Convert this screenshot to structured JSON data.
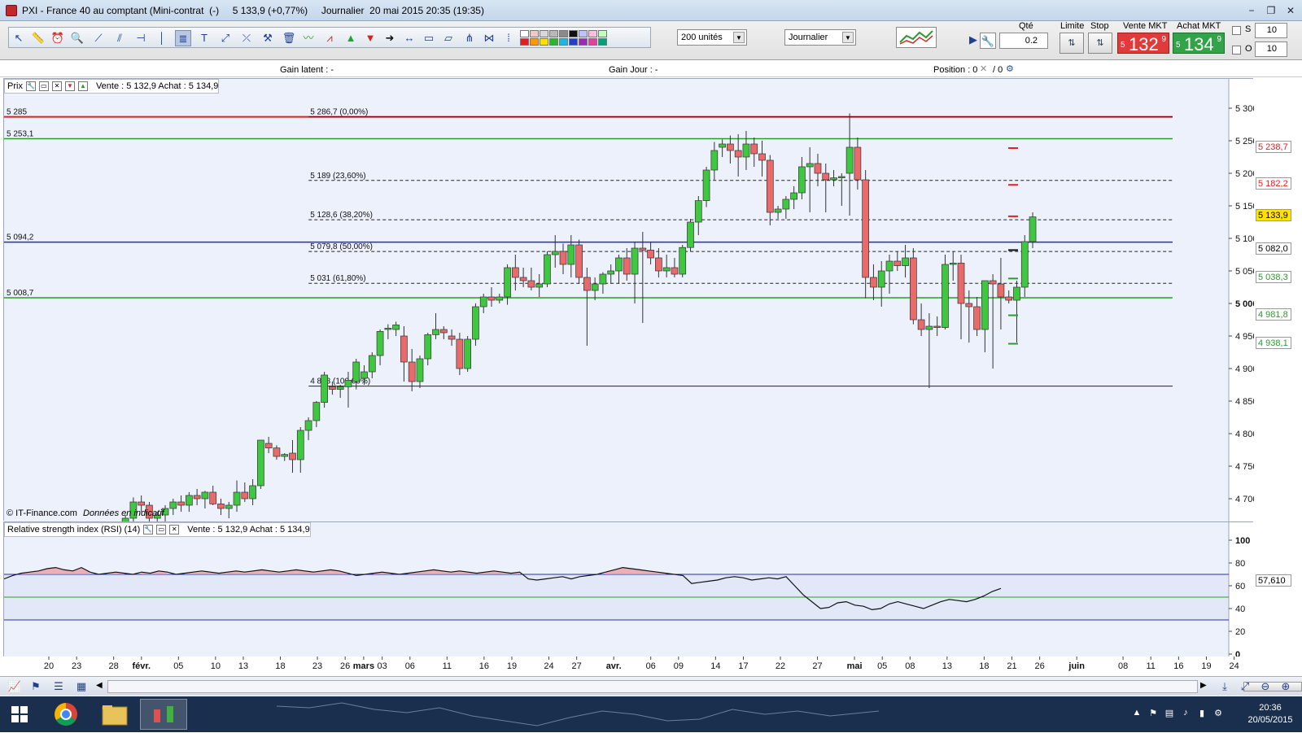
{
  "window": {
    "title": "PXI - France 40 au comptant (Mini-contrat  (-)     5 133,9 (+0,77%)     Journalier  20 mai 2015 20:35 (19:35)",
    "minimize": "−",
    "restore": "❐",
    "close": "✕"
  },
  "toolbar": {
    "units_select": "200 unités",
    "period_select": "Journalier",
    "qty_label": "Qté",
    "qty_value": "0.2",
    "limit_label": "Limite",
    "stop_label": "Stop",
    "sell_label": "Vente MKT",
    "buy_label": "Achat MKT",
    "sell_small": "5",
    "sell_big": "132",
    "sell_sup": "9",
    "buy_small": "5",
    "buy_big": "134",
    "buy_sup": "9",
    "s_label": "S",
    "o_label": "O",
    "s_value": "10",
    "o_value": "10",
    "colors": {
      "sell": "#e03b3b",
      "buy": "#33a34a"
    }
  },
  "infobar": {
    "gain_latent": "Gain latent : -",
    "gain_jour": "Gain Jour : -",
    "position": "Position : 0",
    "position_after": "/ 0"
  },
  "price_panel": {
    "label": "Prix",
    "quote": "Vente : 5 132,9  Achat : 5 134,9",
    "copyright": "© IT-Finance.com",
    "indicative": "Données en indicatif"
  },
  "rsi_panel": {
    "label": "Relative strength index (RSI) (14)",
    "quote": "Vente : 5 132,9  Achat : 5 134,9",
    "value_tag": "57,610"
  },
  "chart_data": [
    {
      "type": "candlestick",
      "title": "PXI - France 40 au comptant (Mini-contrat",
      "ylim": [
        4670,
        5320
      ],
      "y_ticks": [
        {
          "v": 5300,
          "t": "5 300"
        },
        {
          "v": 5250,
          "t": "5 250"
        },
        {
          "v": 5200,
          "t": "5 200"
        },
        {
          "v": 5150,
          "t": "5 150"
        },
        {
          "v": 5100,
          "t": "5 100"
        },
        {
          "v": 5050,
          "t": "5 050"
        },
        {
          "v": 5000,
          "t": "5 000",
          "bold": true
        },
        {
          "v": 4950,
          "t": "4 950"
        },
        {
          "v": 4900,
          "t": "4 900"
        },
        {
          "v": 4850,
          "t": "4 850"
        },
        {
          "v": 4800,
          "t": "4 800"
        },
        {
          "v": 4750,
          "t": "4 750"
        },
        {
          "v": 4700,
          "t": "4 700"
        }
      ],
      "x_ticks": [
        {
          "i": 0,
          "t": "20"
        },
        {
          "i": 3,
          "t": "23"
        },
        {
          "i": 7,
          "t": "28"
        },
        {
          "i": 10,
          "t": "févr."
        },
        {
          "i": 14,
          "t": "05"
        },
        {
          "i": 18,
          "t": "10"
        },
        {
          "i": 21,
          "t": "13"
        },
        {
          "i": 25,
          "t": "18"
        },
        {
          "i": 29,
          "t": "23"
        },
        {
          "i": 32,
          "t": "26"
        },
        {
          "i": 34,
          "t": "mars"
        },
        {
          "i": 36,
          "t": "03"
        },
        {
          "i": 39,
          "t": "06"
        },
        {
          "i": 43,
          "t": "11"
        },
        {
          "i": 47,
          "t": "16"
        },
        {
          "i": 50,
          "t": "19"
        },
        {
          "i": 54,
          "t": "24"
        },
        {
          "i": 57,
          "t": "27"
        },
        {
          "i": 61,
          "t": "avr."
        },
        {
          "i": 65,
          "t": "06"
        },
        {
          "i": 68,
          "t": "09"
        },
        {
          "i": 72,
          "t": "14"
        },
        {
          "i": 75,
          "t": "17"
        },
        {
          "i": 79,
          "t": "22"
        },
        {
          "i": 83,
          "t": "27"
        },
        {
          "i": 87,
          "t": "mai"
        },
        {
          "i": 90,
          "t": "05"
        },
        {
          "i": 93,
          "t": "08"
        },
        {
          "i": 97,
          "t": "13"
        },
        {
          "i": 101,
          "t": "18"
        },
        {
          "i": 104,
          "t": "21"
        },
        {
          "i": 107,
          "t": "26"
        },
        {
          "i": 111,
          "t": "juin"
        },
        {
          "i": 116,
          "t": "08"
        },
        {
          "i": 119,
          "t": "11"
        },
        {
          "i": 122,
          "t": "16"
        },
        {
          "i": 125,
          "t": "19"
        },
        {
          "i": 128,
          "t": "24"
        }
      ],
      "h_lines": [
        {
          "v": 5286.7,
          "label": "5 285",
          "color": "#e02020",
          "width": 2
        },
        {
          "v": 5253.1,
          "label": "5 253,1",
          "color": "#2d9a2d",
          "width": 1.5
        },
        {
          "v": 5094.2,
          "label": "5 094,2",
          "color": "#2a2ab0",
          "width": 1.5
        },
        {
          "v": 5008.7,
          "label": "5 008,7",
          "color": "#2d9a2d",
          "width": 1.5
        }
      ],
      "fibonacci": [
        {
          "v": 5286.7,
          "label": "5 286,7 (0,00%)",
          "solid": true
        },
        {
          "v": 5189,
          "label": "5 189 (23,60%)"
        },
        {
          "v": 5128.6,
          "label": "5 128,6 (38,20%)"
        },
        {
          "v": 5079.8,
          "label": "5 079,8 (50,00%)"
        },
        {
          "v": 5031,
          "label": "5 031 (61,80%)"
        },
        {
          "v": 4873,
          "label": "4 873 (100,00%)",
          "solid": true
        }
      ],
      "fib_start_index": 31,
      "right_tags": [
        {
          "v": 5238.7,
          "t": "5 238,7",
          "color": "#e02020",
          "bg": "#fff"
        },
        {
          "v": 5182.2,
          "t": "5 182,2",
          "color": "#e02020",
          "bg": "#fff"
        },
        {
          "v": 5133.9,
          "t": "5 133,9",
          "color": "#000",
          "bg": "#ffe400"
        },
        {
          "v": 5082.0,
          "t": "5 082,0",
          "color": "#000",
          "bg": "#fff"
        },
        {
          "v": 5038.3,
          "t": "5 038,3",
          "color": "#2d9a2d",
          "bg": "#fff"
        },
        {
          "v": 4981.8,
          "t": "4 981,8",
          "color": "#2d9a2d",
          "bg": "#fff"
        },
        {
          "v": 4938.1,
          "t": "4 938,1",
          "color": "#2d9a2d",
          "bg": "#fff"
        }
      ],
      "candles": [
        [
          4655,
          4665,
          4640,
          4650
        ],
        [
          4650,
          4660,
          4635,
          4645
        ],
        [
          4645,
          4655,
          4630,
          4652
        ],
        [
          4652,
          4662,
          4640,
          4648
        ],
        [
          4648,
          4675,
          4640,
          4670
        ],
        [
          4670,
          4702,
          4660,
          4695
        ],
        [
          4695,
          4705,
          4680,
          4690
        ],
        [
          4690,
          4695,
          4665,
          4670
        ],
        [
          4670,
          4680,
          4655,
          4675
        ],
        [
          4675,
          4690,
          4665,
          4685
        ],
        [
          4685,
          4700,
          4675,
          4695
        ],
        [
          4695,
          4705,
          4680,
          4690
        ],
        [
          4690,
          4710,
          4680,
          4705
        ],
        [
          4705,
          4715,
          4690,
          4700
        ],
        [
          4700,
          4712,
          4685,
          4710
        ],
        [
          4710,
          4720,
          4690,
          4692
        ],
        [
          4692,
          4700,
          4675,
          4685
        ],
        [
          4685,
          4695,
          4670,
          4690
        ],
        [
          4690,
          4728,
          4680,
          4710
        ],
        [
          4710,
          4725,
          4695,
          4700
        ],
        [
          4700,
          4730,
          4690,
          4720
        ],
        [
          4720,
          4790,
          4715,
          4790
        ],
        [
          4785,
          4795,
          4770,
          4778
        ],
        [
          4778,
          4782,
          4760,
          4765
        ],
        [
          4765,
          4770,
          4758,
          4768
        ],
        [
          4770,
          4790,
          4740,
          4760
        ],
        [
          4760,
          4810,
          4740,
          4805
        ],
        [
          4805,
          4825,
          4790,
          4820
        ],
        [
          4820,
          4850,
          4810,
          4848
        ],
        [
          4848,
          4895,
          4840,
          4890
        ],
        [
          4872,
          4880,
          4860,
          4868
        ],
        [
          4868,
          4875,
          4855,
          4872
        ],
        [
          4872,
          4895,
          4840,
          4882
        ],
        [
          4880,
          4915,
          4868,
          4910
        ],
        [
          4885,
          4905,
          4875,
          4895
        ],
        [
          4895,
          4925,
          4885,
          4920
        ],
        [
          4920,
          4960,
          4905,
          4957
        ],
        [
          4960,
          4968,
          4945,
          4962
        ],
        [
          4960,
          4972,
          4950,
          4967
        ],
        [
          4950,
          4965,
          4880,
          4910
        ],
        [
          4910,
          4930,
          4865,
          4880
        ],
        [
          4880,
          4920,
          4870,
          4915
        ],
        [
          4915,
          4955,
          4905,
          4952
        ],
        [
          4952,
          4985,
          4945,
          4960
        ],
        [
          4960,
          4965,
          4945,
          4955
        ],
        [
          4950,
          4960,
          4935,
          4945
        ],
        [
          4945,
          4955,
          4890,
          4900
        ],
        [
          4900,
          4950,
          4895,
          4945
        ],
        [
          4945,
          5000,
          4935,
          4995
        ],
        [
          4995,
          5015,
          4985,
          5010
        ],
        [
          5010,
          5025,
          4995,
          5005
        ],
        [
          5005,
          5015,
          5000,
          5010
        ],
        [
          5010,
          5060,
          4998,
          5055
        ],
        [
          5055,
          5075,
          5020,
          5040
        ],
        [
          5040,
          5055,
          5025,
          5035
        ],
        [
          5035,
          5055,
          5020,
          5025
        ],
        [
          5025,
          5045,
          5010,
          5030
        ],
        [
          5030,
          5080,
          5025,
          5075
        ],
        [
          5075,
          5105,
          5055,
          5080
        ],
        [
          5080,
          5092,
          5045,
          5060
        ],
        [
          5060,
          5105,
          5040,
          5090
        ],
        [
          5090,
          5098,
          5030,
          5040
        ],
        [
          5040,
          5055,
          4935,
          5020
        ],
        [
          5020,
          5040,
          5005,
          5030
        ],
        [
          5030,
          5048,
          5015,
          5045
        ],
        [
          5045,
          5060,
          5030,
          5050
        ],
        [
          5050,
          5075,
          5030,
          5070
        ],
        [
          5070,
          5085,
          5035,
          5045
        ],
        [
          5045,
          5095,
          5000,
          5085
        ],
        [
          5085,
          5110,
          4970,
          5082
        ],
        [
          5082,
          5095,
          5060,
          5070
        ],
        [
          5070,
          5085,
          5040,
          5050
        ],
        [
          5050,
          5075,
          5040,
          5055
        ],
        [
          5055,
          5070,
          5040,
          5045
        ],
        [
          5045,
          5090,
          5040,
          5086
        ],
        [
          5086,
          5130,
          5080,
          5125
        ],
        [
          5125,
          5165,
          5105,
          5158
        ],
        [
          5158,
          5210,
          5148,
          5205
        ],
        [
          5205,
          5248,
          5190,
          5235
        ],
        [
          5240,
          5252,
          5225,
          5245
        ],
        [
          5245,
          5258,
          5215,
          5235
        ],
        [
          5235,
          5260,
          5195,
          5225
        ],
        [
          5225,
          5265,
          5205,
          5245
        ],
        [
          5245,
          5255,
          5210,
          5230
        ],
        [
          5230,
          5250,
          5195,
          5220
        ],
        [
          5220,
          5228,
          5120,
          5140
        ],
        [
          5140,
          5150,
          5130,
          5145
        ],
        [
          5145,
          5165,
          5130,
          5160
        ],
        [
          5160,
          5180,
          5145,
          5170
        ],
        [
          5170,
          5225,
          5160,
          5210
        ],
        [
          5210,
          5240,
          5140,
          5215
        ],
        [
          5215,
          5230,
          5180,
          5200
        ],
        [
          5200,
          5215,
          5140,
          5190
        ],
        [
          5190,
          5205,
          5180,
          5193
        ],
        [
          5193,
          5200,
          5150,
          5195
        ],
        [
          5200,
          5292,
          5135,
          5240
        ],
        [
          5240,
          5255,
          5175,
          5190
        ],
        [
          5190,
          5205,
          5008,
          5040
        ],
        [
          5040,
          5060,
          5005,
          5025
        ],
        [
          5025,
          5065,
          4995,
          5050
        ],
        [
          5050,
          5075,
          5015,
          5065
        ],
        [
          5065,
          5080,
          5050,
          5058
        ],
        [
          5058,
          5090,
          5040,
          5070
        ],
        [
          5070,
          5085,
          4968,
          4975
        ],
        [
          4975,
          5000,
          4950,
          4960
        ],
        [
          4960,
          4985,
          4870,
          4965
        ],
        [
          4965,
          4980,
          4950,
          4963
        ],
        [
          4963,
          5075,
          4960,
          5060
        ],
        [
          5060,
          5080,
          5035,
          5062
        ],
        [
          5062,
          5075,
          4945,
          5000
        ],
        [
          5000,
          5020,
          4940,
          4995
        ],
        [
          4995,
          5010,
          4950,
          4960
        ],
        [
          4960,
          5030,
          4925,
          5035
        ],
        [
          5035,
          5045,
          4900,
          5030
        ],
        [
          5030,
          5070,
          4960,
          5010
        ],
        [
          5010,
          5020,
          5000,
          5005
        ],
        [
          5005,
          5035,
          4940,
          5025
        ],
        [
          5025,
          5105,
          5010,
          5095
        ],
        [
          5095,
          5140,
          5085,
          5133
        ]
      ]
    },
    {
      "type": "line",
      "title": "Relative strength index (RSI) (14)",
      "ylim": [
        0,
        100
      ],
      "y_ticks": [
        {
          "v": 100,
          "t": "100",
          "bold": true
        },
        {
          "v": 80,
          "t": "80"
        },
        {
          "v": 60,
          "t": "60"
        },
        {
          "v": 40,
          "t": "40"
        },
        {
          "v": 20,
          "t": "20"
        },
        {
          "v": 0,
          "t": "0",
          "bold": true
        }
      ],
      "bands": [
        70,
        50,
        30
      ],
      "series": [
        {
          "values": [
            66,
            69,
            71,
            72,
            73,
            75,
            76,
            74,
            73,
            76,
            72,
            70,
            71,
            72,
            71,
            70,
            72,
            71,
            73,
            72,
            70,
            71,
            72,
            73,
            72,
            71,
            72,
            73,
            72,
            73,
            74,
            73,
            72,
            73,
            74,
            73,
            72,
            73,
            74,
            73,
            71,
            69,
            70,
            71,
            72,
            71,
            70,
            71,
            72,
            73,
            74,
            73,
            72,
            73,
            72,
            71,
            72,
            73,
            72,
            71,
            72,
            66,
            65,
            66,
            67,
            68,
            66,
            68,
            69,
            70,
            72,
            74,
            76,
            75,
            74,
            73,
            72,
            71,
            70,
            69,
            62,
            63,
            64,
            65,
            67,
            68,
            67,
            65,
            66,
            67,
            66,
            68,
            60,
            52,
            46,
            40,
            41,
            45,
            46,
            43,
            42,
            39,
            40,
            44,
            46,
            44,
            42,
            40,
            43,
            46,
            48,
            47,
            46,
            48,
            51,
            55,
            57.6
          ]
        }
      ]
    }
  ]
}
